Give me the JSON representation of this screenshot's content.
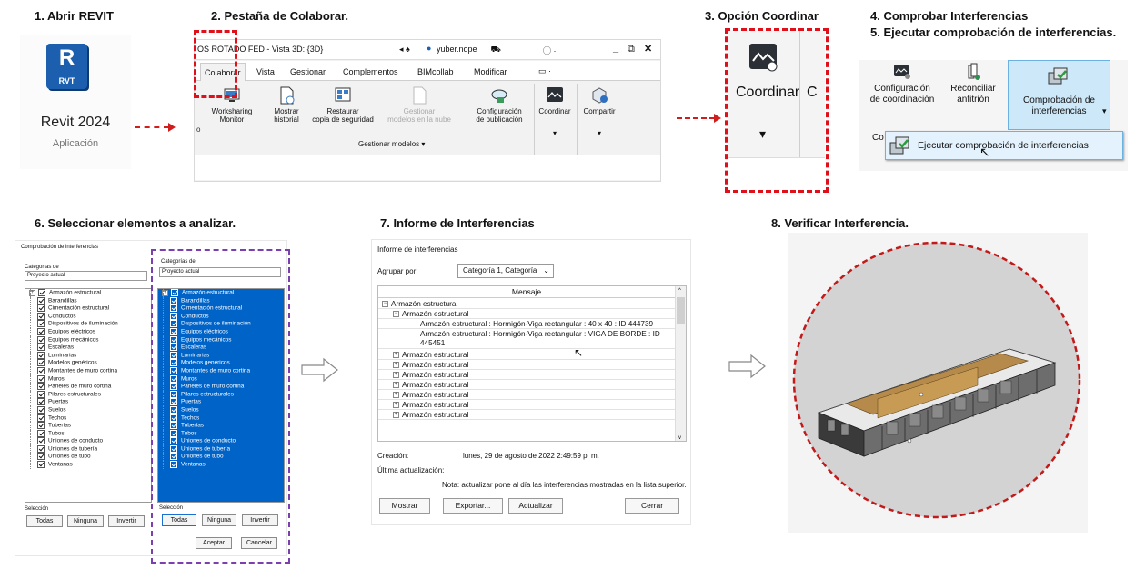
{
  "steps": {
    "s1": "1. Abrir REVIT",
    "s2": "2. Pestaña de Colaborar.",
    "s3": "3. Opción Coordinar",
    "s4": "4. Comprobar Interferencias",
    "s5": "5. Ejecutar comprobación de interferencias.",
    "s6": "6. Seleccionar elementos a analizar.",
    "s7": "7. Informe de Interferencias",
    "s8": "8. Verificar Interferencia."
  },
  "revit": {
    "logo_letter": "R",
    "logo_tag": "RVT",
    "app_name": "Revit 2024",
    "app_type": "Aplicación",
    "logo_color": "#1b5fae"
  },
  "ribbon": {
    "title": "OS ROTADO FED - Vista 3D: {3D}",
    "user": "yuber.nope",
    "tabs": [
      "Colaborar",
      "Vista",
      "Gestionar",
      "Complementos",
      "BIMcollab",
      "Modificar"
    ],
    "buttons": {
      "o": "o",
      "worksharing": [
        "Worksharing",
        "Monitor"
      ],
      "historial": [
        "Mostrar",
        "historial"
      ],
      "restaurar": [
        "Restaurar",
        "copia de seguridad"
      ],
      "gestionar": [
        "Gestionar",
        "modelos en la nube"
      ],
      "publicacion": [
        "Configuración",
        "de publicación"
      ],
      "coordinar": "Coordinar",
      "compartir": "Compartir"
    },
    "group_label": "Gestionar modelos ▾"
  },
  "coordinar_zoom": {
    "label": "Coordinar",
    "cut": "C"
  },
  "step4_panel": {
    "config": [
      "Configuración",
      "de coordinación"
    ],
    "reconciliar": [
      "Reconciliar",
      "anfitrión"
    ],
    "comprobacion": [
      "Comprobación de",
      "interferencias"
    ],
    "co": "Co",
    "ejecutar": "Ejecutar comprobación de interferencias"
  },
  "clash_dialog": {
    "title": "Comprobación de interferencias",
    "left_cat_label": "Categorías de",
    "right_cat_label": "Categorías de",
    "left_source": "Proyecto actual",
    "right_source": "Proyecto actual",
    "categories": [
      "Armazón estructural",
      "Barandillas",
      "Cimentación estructural",
      "Conductos",
      "Dispositivos de iluminación",
      "Equipos eléctricos",
      "Equipos mecánicos",
      "Escaleras",
      "Luminarias",
      "Modelos genéricos",
      "Montantes de muro cortina",
      "Muros",
      "Paneles de muro cortina",
      "Pilares estructurales",
      "Puertas",
      "Suelos",
      "Techos",
      "Tuberías",
      "Tubos",
      "Uniones de conducto",
      "Uniones de tubería",
      "Uniones de tubo",
      "Ventanas"
    ],
    "seleccion": "Selección",
    "todas": "Todas",
    "ninguna": "Ninguna",
    "invertir": "Invertir",
    "aceptar": "Aceptar",
    "cancelar": "Cancelar"
  },
  "report": {
    "title": "Informe de interferencias",
    "group_label": "Agrupar por:",
    "group_value": "Categoría 1, Categoría",
    "column": "Mensaje",
    "root": "Armazón estructural",
    "child": "Armazón estructural",
    "item1": "Armazón estructural : Hormigón-Viga rectangular : 40 x 40 : ID 444739",
    "item2a": "Armazón estructural : Hormigón-Viga rectangular : VIGA DE BORDE : ID",
    "item2b": "445451",
    "collapsed": [
      "Armazón estructural",
      "Armazón estructural",
      "Armazón estructural",
      "Armazón estructural",
      "Armazón estructural",
      "Armazón estructural",
      "Armazón estructural"
    ],
    "creacion_label": "Creación:",
    "creacion_value": "lunes, 29 de agosto de 2022 2:49:59 p. m.",
    "ultima_label": "Última actualización:",
    "nota": "Nota: actualizar pone al día las interferencias mostradas en la lista superior.",
    "mostrar": "Mostrar",
    "exportar": "Exportar...",
    "actualizar": "Actualizar",
    "cerrar": "Cerrar"
  },
  "colors": {
    "red_dash": "#e0101b",
    "purple_dash": "#7b3fb0",
    "selection_blue": "#0063c7"
  }
}
